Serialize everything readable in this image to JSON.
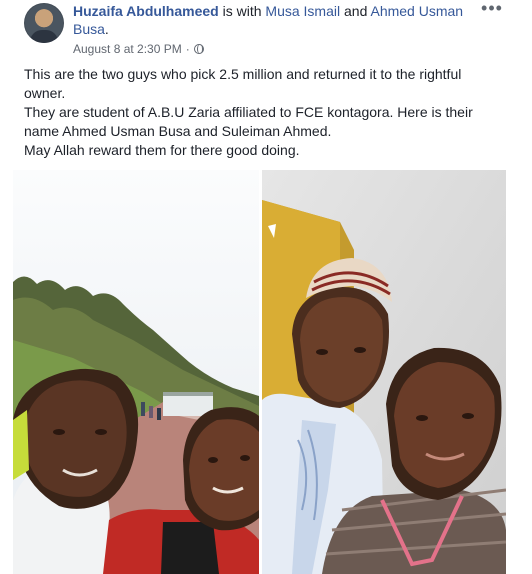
{
  "post": {
    "author": "Huzaifa Abdulhameed",
    "with_text": " is with ",
    "tagged_1": "Musa Ismail",
    "and_text": " and ",
    "tagged_2": "Ahmed Usman Busa",
    "period": ".",
    "timestamp": "August 8 at 2:30 PM",
    "separator": " · ",
    "more_glyph": "•••",
    "paragraphs": [
      "This are the two guys who pick 2.5 million and returned it to the rightful owner.",
      "They are student of A.B.U Zaria affiliated to FCE kontagora. Here is their name Ahmed Usman Busa and Suleiman Ahmed.",
      "May Allah reward them for there good doing."
    ]
  },
  "icons": {
    "privacy": "globe-icon",
    "options": "more-options-icon"
  },
  "colors": {
    "name_link": "#365899",
    "text": "#1d2129",
    "meta": "#616770"
  }
}
